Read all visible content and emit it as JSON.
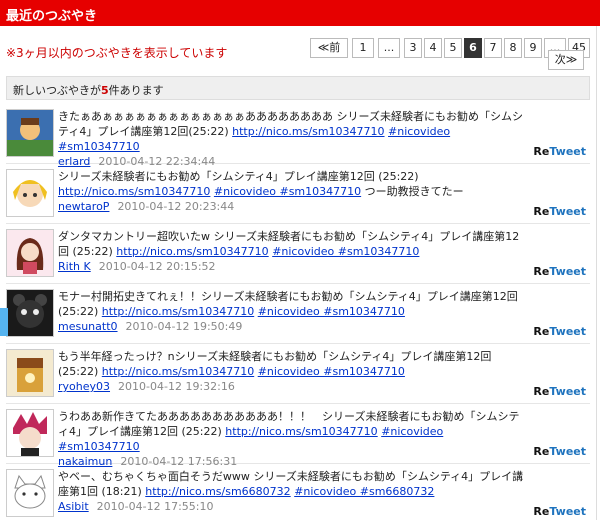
{
  "header": {
    "title": "最近のつぶやき"
  },
  "notice": "※3ヶ月以内のつぶやきを表示しています",
  "pagination": {
    "prev_label": "≪前",
    "next_label": "次≫",
    "pages": [
      "1",
      "...",
      "3",
      "4",
      "5",
      "6",
      "7",
      "8",
      "9",
      "...",
      "45"
    ],
    "current": "6"
  },
  "count_bar": {
    "prefix": "新しいつぶやきが",
    "count": "5",
    "suffix": "件あります"
  },
  "retweet_label": {
    "re": "Re",
    "tweet": "Tweet"
  },
  "tweets": [
    {
      "text": "きたぁあぁぁぁぁぁぁぁぁぁぁぁぁぁああああああああ シリーズ未経験者にもお勧め「シムシティ4」プレイ講座第12回(25:22)",
      "link": "http://nico.ms/sm10347710",
      "tags": "#nicovideo #sm10347710",
      "user": "erlard",
      "time": "2010-04-12 22:34:44"
    },
    {
      "text": "シリーズ未経験者にもお勧め「シムシティ4」プレイ講座第12回 (25:22)",
      "link": "http://nico.ms/sm10347710",
      "tags": "#nicovideo #sm10347710",
      "extra": "つー助教授きてたー",
      "user": "newtaroP",
      "time": "2010-04-12 20:23:44"
    },
    {
      "text": "ダンタマカントリー超吹いたw シリーズ未経験者にもお勧め「シムシティ4」プレイ講座第12回 (25:22)",
      "link": "http://nico.ms/sm10347710",
      "tags": "#nicovideo #sm10347710",
      "user": "Rith K",
      "time": "2010-04-12 20:15:52"
    },
    {
      "text": "モナー村開拓史きてれぇ！！シリーズ未経験者にもお勧め「シムシティ4」プレイ講座第12回 (25:22)",
      "link": "http://nico.ms/sm10347710",
      "tags": "#nicovideo #sm10347710",
      "user": "mesunatt0",
      "time": "2010-04-12 19:50:49"
    },
    {
      "text": "もう半年経ったっけ？nシリーズ未経験者にもお勧め「シムシティ4」プレイ講座第12回 (25:22)",
      "link": "http://nico.ms/sm10347710",
      "tags": "#nicovideo #sm10347710",
      "user": "ryohey03",
      "time": "2010-04-12 19:32:16"
    },
    {
      "text": "うわああ新作きてたあああああああああああ！！！　シリーズ未経験者にもお勧め「シムシティ4」プレイ講座第12回 (25:22)",
      "link": "http://nico.ms/sm10347710",
      "tags": "#nicovideo #sm10347710",
      "user": "nakaimun",
      "time": "2010-04-12 17:56:31"
    },
    {
      "text": "やベー、むちゃくちゃ面白そうだwww シリーズ未経験者にもお勧め「シムシティ4」プレイ講座第1回 (18:21)",
      "link": "http://nico.ms/sm6680732",
      "tags": "#nicovideo #sm6680732",
      "user": "Asibit",
      "time": "2010-04-12 17:55:10"
    }
  ],
  "colors": {
    "header": "#e60000",
    "notice": "#cc0000",
    "link": "#0033cc",
    "tweet_blue": "#1e73be"
  }
}
